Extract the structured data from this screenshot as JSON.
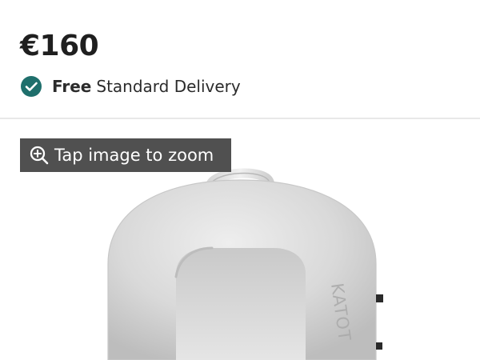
{
  "header": {
    "top_partial_text": "— — — —"
  },
  "product": {
    "price": "€160"
  },
  "delivery": {
    "free_label": "Free",
    "standard_label": "Standard Delivery"
  },
  "image": {
    "zoom_hint": "Tap image to zoom",
    "brand_mark": "KATOT"
  },
  "icons": {
    "delivery": "check-circle-icon",
    "zoom": "zoom-in-icon"
  },
  "colors": {
    "check_circle": "#1f6f6c",
    "badge_bg": "#505050",
    "badge_text": "#ffffff",
    "price_text": "#1f1f1f",
    "divider": "#e8e8e8"
  }
}
